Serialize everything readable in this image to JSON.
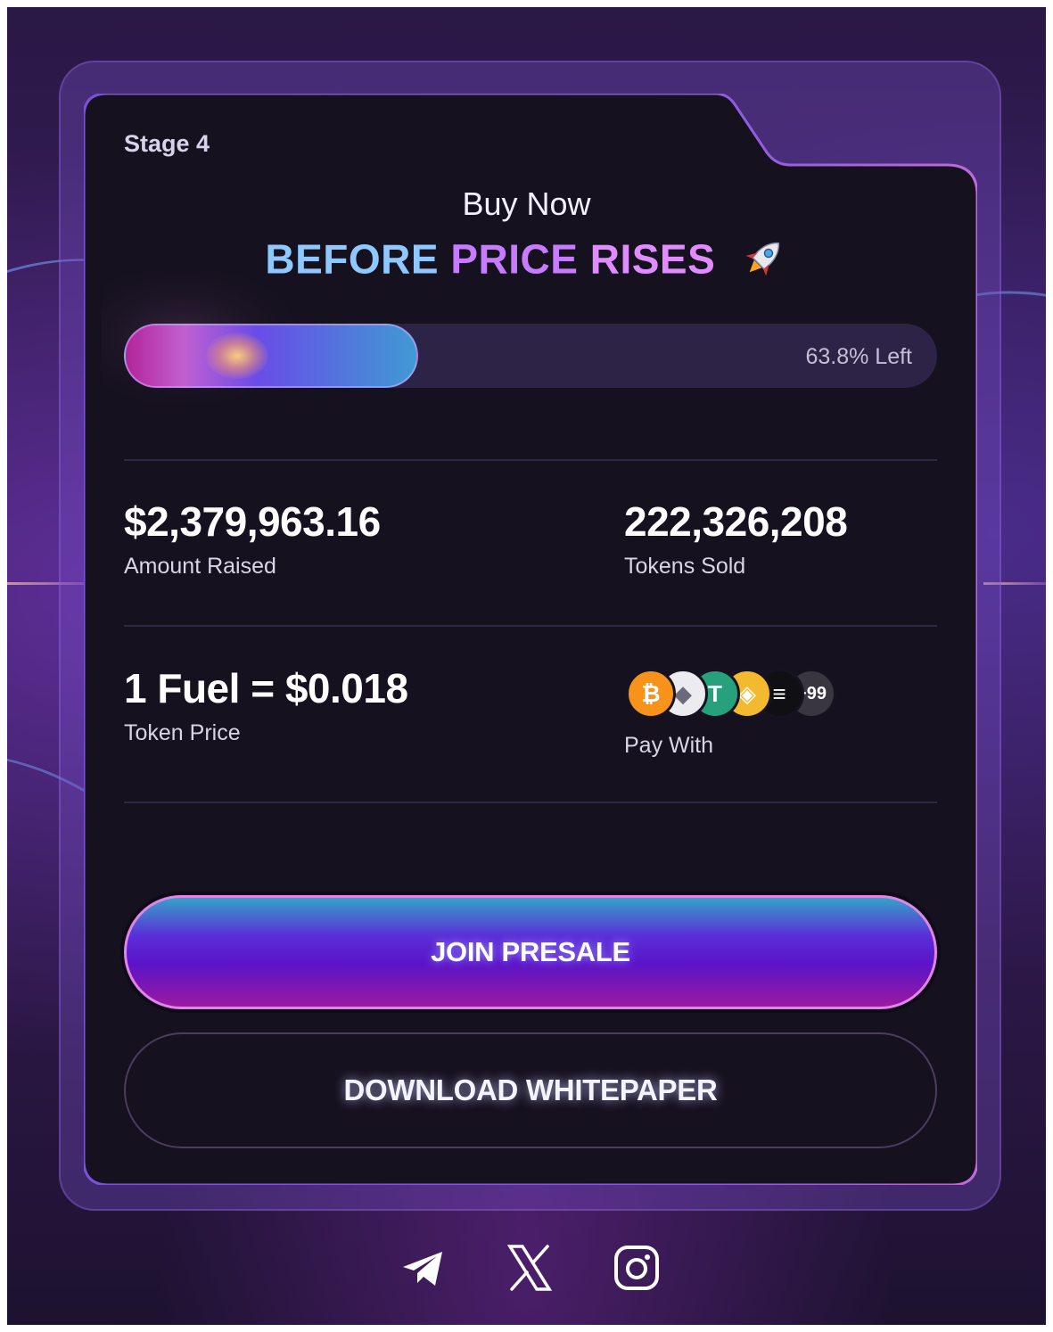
{
  "card": {
    "stage": "Stage 4",
    "title_line1": "Buy Now",
    "headline": {
      "before": "BEFORE",
      "price": "PRICE",
      "rises": "RISES"
    }
  },
  "progress": {
    "fill_fraction": 0.362,
    "label": "63.8% Left"
  },
  "stats": {
    "amount_raised": {
      "value": "$2,379,963.16",
      "label": "Amount Raised"
    },
    "tokens_sold": {
      "value": "222,326,208",
      "label": "Tokens Sold"
    },
    "token_price": {
      "value": "1 Fuel = $0.018",
      "label": "Token Price"
    },
    "pay_with": {
      "label": "Pay With",
      "coins": [
        {
          "name": "bitcoin-icon",
          "glyph": "₿",
          "color": "#f7931a"
        },
        {
          "name": "ethereum-icon",
          "glyph": "◆",
          "color": "#ecebf0"
        },
        {
          "name": "tether-icon",
          "glyph": "T",
          "color": "#26a17b"
        },
        {
          "name": "bnb-icon",
          "glyph": "◈",
          "color": "#f3ba2f"
        },
        {
          "name": "solana-icon",
          "glyph": "≡",
          "color": "#101014"
        }
      ],
      "more": "+99"
    }
  },
  "buttons": {
    "join": "JOIN PRESALE",
    "whitepaper": "DOWNLOAD WHITEPAPER"
  },
  "social": [
    "telegram-icon",
    "x-icon",
    "instagram-icon"
  ],
  "colors": {
    "card_bg": "#15111f",
    "accent_blue": "#8ec8ff",
    "accent_purple": "#c77bff",
    "button_border": "#e283e6"
  }
}
